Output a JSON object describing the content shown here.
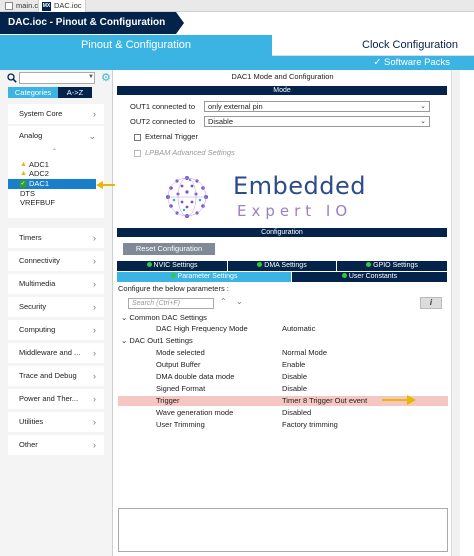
{
  "editor_tabs": [
    {
      "label": "main.c",
      "icon": "c-file-icon"
    },
    {
      "label": "DAC.ioc",
      "icon": "mx-file-icon"
    }
  ],
  "breadcrumb": {
    "label": "DAC.ioc - Pinout & Configuration"
  },
  "header": {
    "pinout_tab": "Pinout & Configuration",
    "clock_tab": "Clock Configuration",
    "software_packs": "✓ Software Packs"
  },
  "sidebar": {
    "tabs": {
      "categories": "Categories",
      "az": "A->Z"
    },
    "categories": [
      {
        "label": "System Core",
        "chevron": ">"
      },
      {
        "label": "Analog",
        "chevron": "v"
      },
      {
        "label": "Timers",
        "chevron": ">"
      },
      {
        "label": "Connectivity",
        "chevron": ">"
      },
      {
        "label": "Multimedia",
        "chevron": ">"
      },
      {
        "label": "Security",
        "chevron": ">"
      },
      {
        "label": "Computing",
        "chevron": ">"
      },
      {
        "label": "Middleware and ...",
        "chevron": ">"
      },
      {
        "label": "Trace and Debug",
        "chevron": ">"
      },
      {
        "label": "Power and Ther...",
        "chevron": ">"
      },
      {
        "label": "Utilities",
        "chevron": ">"
      },
      {
        "label": "Other",
        "chevron": ">"
      }
    ],
    "analog_items": [
      {
        "label": "ADC1",
        "status": "warning"
      },
      {
        "label": "ADC2",
        "status": "warning"
      },
      {
        "label": "DAC1",
        "status": "enabled"
      },
      {
        "label": "DTS",
        "status": "none"
      },
      {
        "label": "VREFBUF",
        "status": "none"
      }
    ]
  },
  "config_panel": {
    "title": "DAC1 Mode and Configuration",
    "mode_section": "Mode",
    "out1_label": "OUT1 connected to",
    "out1_value": "only external pin",
    "out2_label": "OUT2 connected to",
    "out2_value": "Disable",
    "external_trigger": "External Trigger",
    "lpbam": "LPBAM Advanced Settings",
    "configuration_section": "Configuration",
    "reset_button": "Reset Configuration",
    "settings_tabs": [
      {
        "label": "NVIC Settings"
      },
      {
        "label": "DMA Settings"
      },
      {
        "label": "GPIO Settings"
      },
      {
        "label": "Parameter Settings",
        "active": true
      },
      {
        "label": "User Constants"
      }
    ],
    "configure_below": "Configure the below parameters :",
    "search_placeholder": "Search (Ctrl+F)",
    "info_icon": "i",
    "groups": [
      {
        "name": "Common DAC Settings",
        "params": [
          {
            "key": "DAC High Frequency Mode",
            "value": "Automatic"
          }
        ]
      },
      {
        "name": "DAC Out1 Settings",
        "params": [
          {
            "key": "Mode selected",
            "value": "Normal Mode"
          },
          {
            "key": "Output Buffer",
            "value": "Enable"
          },
          {
            "key": "DMA double data mode",
            "value": "Disable"
          },
          {
            "key": "Signed Format",
            "value": "Disable"
          },
          {
            "key": "Trigger",
            "value": "Timer 8 Trigger Out event",
            "highlighted": true
          },
          {
            "key": "Wave generation mode",
            "value": "Disabled"
          },
          {
            "key": "User Trimming",
            "value": "Factory trimming"
          }
        ]
      }
    ]
  },
  "logo": {
    "line1": "Embedded",
    "line2": "Expert IO"
  },
  "colors": {
    "navy": "#03234b",
    "accent": "#3bb4e4",
    "selection": "#1a7fcb",
    "highlight_row": "#f6c7c2",
    "annotation_arrow": "#e6b800"
  }
}
